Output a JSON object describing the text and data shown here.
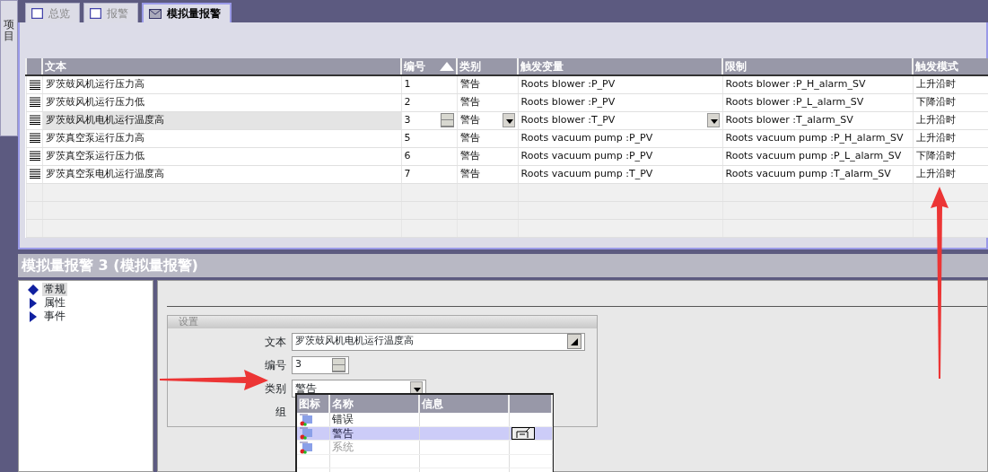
{
  "side_tab": {
    "label": "项目"
  },
  "tabs": [
    {
      "label": "总览",
      "selected": false
    },
    {
      "label": "报警",
      "selected": false
    },
    {
      "label": "模拟量报警",
      "selected": true
    }
  ],
  "table": {
    "columns": [
      {
        "label": "文本",
        "sorted": false
      },
      {
        "label": "编号",
        "sorted": true
      },
      {
        "label": "类别",
        "sorted": false
      },
      {
        "label": "触发变量",
        "sorted": false
      },
      {
        "label": "限制",
        "sorted": false
      },
      {
        "label": "触发模式",
        "sorted": false
      }
    ],
    "rows": [
      {
        "cells": [
          "罗茨鼓风机运行压力高",
          "1",
          "警告",
          "Roots blower :P_PV",
          "Roots blower :P_H_alarm_SV",
          "上升沿时"
        ],
        "selected": false
      },
      {
        "cells": [
          "罗茨鼓风机运行压力低",
          "2",
          "警告",
          "Roots blower :P_PV",
          "Roots blower :P_L_alarm_SV",
          "下降沿时"
        ],
        "selected": false
      },
      {
        "cells": [
          "罗茨鼓风机电机运行温度高",
          "3",
          "警告",
          "Roots blower :T_PV",
          "Roots blower :T_alarm_SV",
          "上升沿时"
        ],
        "selected": true
      },
      {
        "cells": [
          "罗茨真空泵运行压力高",
          "5",
          "警告",
          "Roots vacuum pump :P_PV",
          "Roots vacuum pump :P_H_alarm_SV",
          "上升沿时"
        ],
        "selected": false
      },
      {
        "cells": [
          "罗茨真空泵运行压力低",
          "6",
          "警告",
          "Roots vacuum pump :P_PV",
          "Roots vacuum pump :P_L_alarm_SV",
          "下降沿时"
        ],
        "selected": false
      },
      {
        "cells": [
          "罗茨真空泵电机运行温度高",
          "7",
          "警告",
          "Roots vacuum pump :T_PV",
          "Roots vacuum pump :T_alarm_SV",
          "上升沿时"
        ],
        "selected": false
      }
    ]
  },
  "editor": {
    "title": "模拟量报警 3 (模拟量报警)",
    "nav": [
      {
        "label": "常规",
        "selected": true
      },
      {
        "label": "属性",
        "selected": false
      },
      {
        "label": "事件",
        "selected": false
      }
    ],
    "group": {
      "title": "设置",
      "fields": [
        {
          "label": "文本",
          "kind": "text",
          "value": "罗茨鼓风机电机运行温度高"
        },
        {
          "label": "编号",
          "kind": "spin",
          "value": "3"
        },
        {
          "label": "类别",
          "kind": "select",
          "value": "警告"
        },
        {
          "label": "组",
          "kind": "covered"
        }
      ]
    },
    "dropdown": {
      "columns": [
        "图标",
        "名称",
        "信息"
      ],
      "rows": [
        {
          "name": "错误",
          "selected": false,
          "disabled": false
        },
        {
          "name": "警告",
          "selected": true,
          "disabled": false
        },
        {
          "name": "系统",
          "selected": false,
          "disabled": true
        }
      ]
    }
  }
}
